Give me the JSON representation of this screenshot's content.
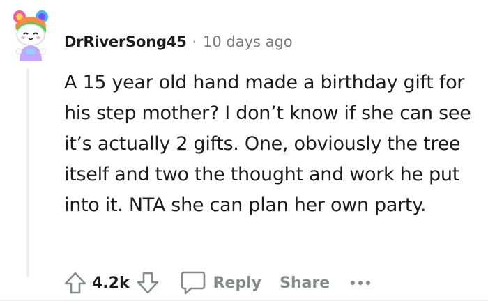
{
  "comment": {
    "username": "DrRiverSong45",
    "separator": "·",
    "timestamp": "10 days ago",
    "body": "A 15 year old hand made a birthday gift for his step mother? I don’t know if she can see it’s actually 2 gifts. One, obviously the tree itself and two the thought and work he put into it. NTA she can plan her own party.",
    "score": "4.2k",
    "reply_label": "Reply",
    "share_label": "Share"
  },
  "icons": {
    "upvote": "arrow-up-icon",
    "downvote": "arrow-down-icon",
    "reply": "speech-bubble-icon",
    "more": "more-dots-icon"
  },
  "colors": {
    "text": "#1c1c1c",
    "muted": "#878a8c",
    "thread_line": "#edeff1"
  }
}
